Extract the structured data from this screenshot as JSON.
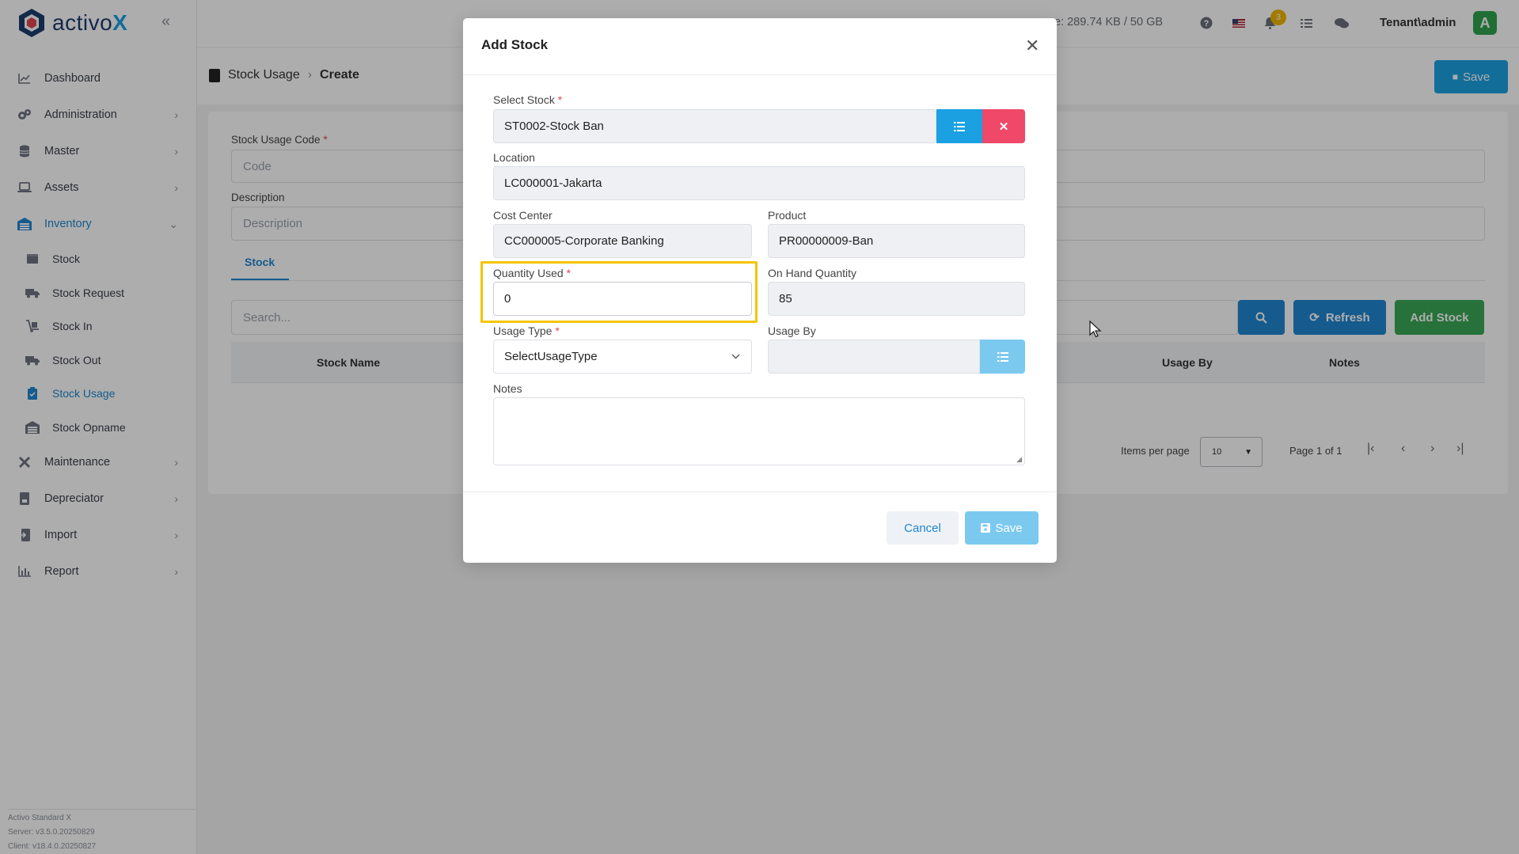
{
  "app": {
    "logo_text": "activo",
    "logo_accent": "X"
  },
  "sidebar": {
    "items": [
      {
        "label": "Dashboard",
        "icon": "chart-line-icon"
      },
      {
        "label": "Administration",
        "icon": "gears-icon"
      },
      {
        "label": "Master",
        "icon": "database-icon"
      },
      {
        "label": "Assets",
        "icon": "laptop-icon"
      },
      {
        "label": "Inventory",
        "icon": "warehouse-icon"
      },
      {
        "label": "Maintenance",
        "icon": "tools-icon"
      },
      {
        "label": "Depreciator",
        "icon": "file-invoice-icon"
      },
      {
        "label": "Import",
        "icon": "file-import-icon"
      },
      {
        "label": "Report",
        "icon": "chart-bar-icon"
      }
    ],
    "inventory_sub": [
      {
        "label": "Stock"
      },
      {
        "label": "Stock Request"
      },
      {
        "label": "Stock In"
      },
      {
        "label": "Stock Out"
      },
      {
        "label": "Stock Usage"
      },
      {
        "label": "Stock Opname"
      }
    ],
    "footer": [
      "Activo Standard X",
      "Server: v3.5.0.20250829",
      "Client: v18.4.0.20250827"
    ]
  },
  "topbar": {
    "storage": "e: 289.74 KB / 50 GB",
    "notification_count": "3",
    "user": "Tenant\\admin",
    "avatar_letter": "A"
  },
  "page": {
    "breadcrumb_parent": "Stock Usage",
    "breadcrumb_current": "Create",
    "save_label": "Save"
  },
  "form": {
    "code_label": "Stock Usage Code",
    "code_placeholder": "Code",
    "description_label": "Description",
    "description_placeholder": "Description",
    "tab_stock": "Stock",
    "search_placeholder": "Search...",
    "refresh_label": "Refresh",
    "add_stock_label": "Add Stock",
    "columns": {
      "stock_name": "Stock Name",
      "usage_by": "Usage By",
      "notes": "Notes"
    },
    "items_per_page_label": "Items per page",
    "items_per_page_value": "10",
    "page_info": "Page 1 of 1"
  },
  "modal": {
    "title": "Add Stock",
    "select_stock_label": "Select Stock",
    "select_stock_value": "ST0002-Stock Ban",
    "location_label": "Location",
    "location_value": "LC000001-Jakarta",
    "cost_center_label": "Cost Center",
    "cost_center_value": "CC000005-Corporate Banking",
    "product_label": "Product",
    "product_value": "PR00000009-Ban",
    "quantity_used_label": "Quantity Used",
    "quantity_used_value": "0",
    "on_hand_label": "On Hand Quantity",
    "on_hand_value": "85",
    "usage_type_label": "Usage Type",
    "usage_type_value": "SelectUsageType",
    "usage_by_label": "Usage By",
    "notes_label": "Notes",
    "cancel_label": "Cancel",
    "save_label": "Save",
    "required_mark": "*"
  }
}
